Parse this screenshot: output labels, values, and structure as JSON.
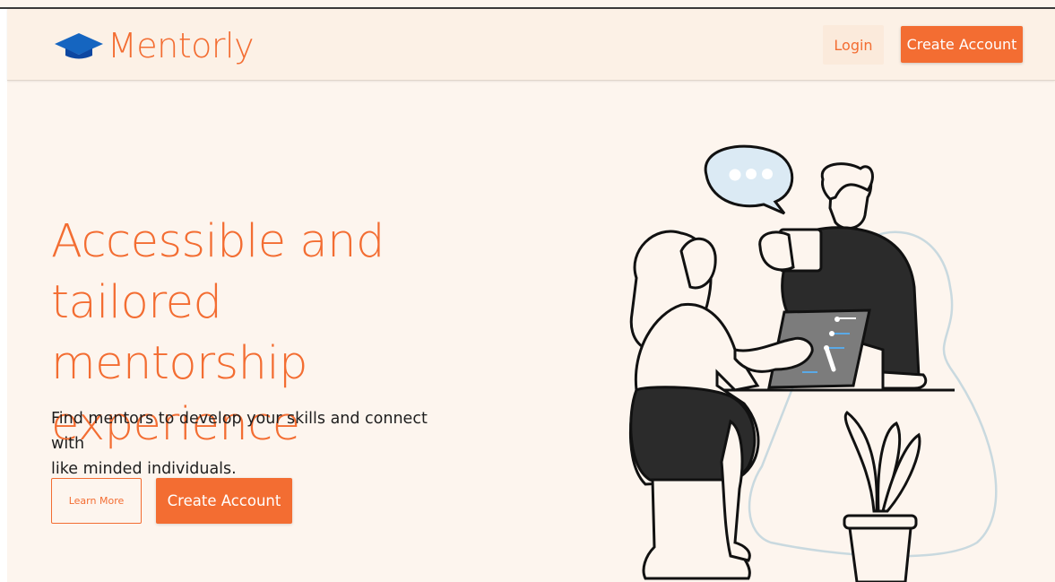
{
  "brand": {
    "name": "Mentorly",
    "icon": "graduation-cap-icon",
    "color": "#f36d32"
  },
  "header": {
    "login_label": "Login",
    "create_account_label": "Create Account"
  },
  "hero": {
    "title_lines": [
      "Accessible and",
      "tailored mentorship",
      "experience"
    ],
    "subtitle_lines": [
      "Find mentors to develop your skills and connect with",
      "like minded individuals."
    ],
    "learn_more_label": "Learn More",
    "create_account_label": "Create Account"
  },
  "illustration": {
    "chat_bubble_dots": 3,
    "accent": "#5aa9e6"
  },
  "colors": {
    "accent": "#f36d32",
    "background": "#fdf5ee",
    "header_bg": "#fcf1e6"
  }
}
